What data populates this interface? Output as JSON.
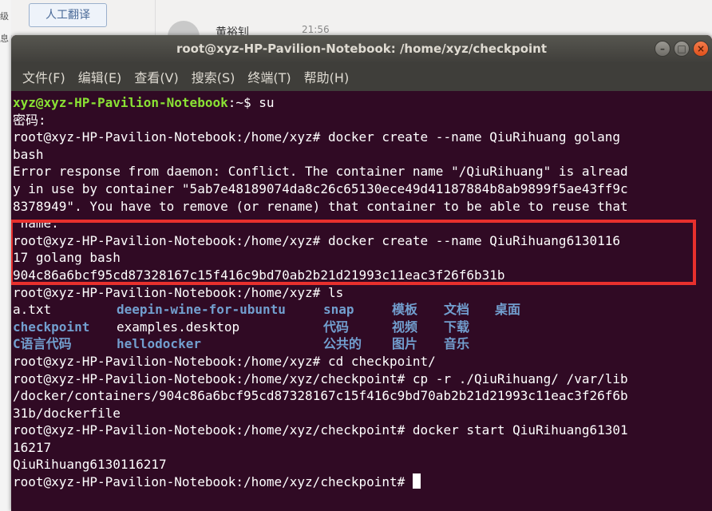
{
  "background": {
    "left_fragments": [
      "级",
      "息"
    ],
    "translate_button": "人工翻译",
    "contact_name": "黄裕钊",
    "contact_time": "21:56"
  },
  "window": {
    "title": "root@xyz-HP-Pavilion-Notebook: /home/xyz/checkpoint",
    "buttons": {
      "minimize": "–",
      "maximize": "□",
      "close": "×"
    }
  },
  "menu": {
    "file": "文件(F)",
    "edit": "编辑(E)",
    "view": "查看(V)",
    "search": "搜索(S)",
    "terminal": "终端(T)",
    "help": "帮助(H)"
  },
  "terminal": {
    "prompt_user_host": "xyz@xyz-HP-Pavilion-Notebook",
    "prompt_user_path": ":~$ su",
    "lines": [
      "密码:",
      "root@xyz-HP-Pavilion-Notebook:/home/xyz# docker create --name QiuRihuang golang",
      "bash",
      "Error response from daemon: Conflict. The container name \"/QiuRihuang\" is alread",
      "y in use by container \"5ab7e48189074da8c26c65130ece49d41187884b8ab9899f5ae43ff9c",
      "8378949\". You have to remove (or rename) that container to be able to reuse that",
      " name.",
      "root@xyz-HP-Pavilion-Notebook:/home/xyz# docker create --name QiuRihuang6130116",
      "17 golang bash",
      "904c86a6bcf95cd87328167c15f416c9bd70ab2b21d21993c11eac3f26f6b31b",
      "root@xyz-HP-Pavilion-Notebook:/home/xyz# ls"
    ],
    "ls_rows": [
      [
        "a.txt",
        "deepin-wine-for-ubuntu",
        "snap",
        "模板",
        "文档",
        "桌面"
      ],
      [
        "checkpoint",
        "examples.desktop",
        "代码",
        "视频",
        "下载",
        ""
      ],
      [
        "C语言代码",
        "hellodocker",
        "公共的",
        "图片",
        "音乐",
        ""
      ]
    ],
    "after_lines": [
      "root@xyz-HP-Pavilion-Notebook:/home/xyz# cd checkpoint/",
      "root@xyz-HP-Pavilion-Notebook:/home/xyz/checkpoint# cp -r ./QiuRihuang/ /var/lib",
      "/docker/containers/904c86a6bcf95cd87328167c15f416c9bd70ab2b21d21993c11eac3f26f6b",
      "31b/dockerfile",
      "root@xyz-HP-Pavilion-Notebook:/home/xyz/checkpoint# docker start QiuRihuang61301",
      "16217",
      "QiuRihuang6130116217"
    ],
    "last_prompt": "root@xyz-HP-Pavilion-Notebook:/home/xyz/checkpoint# "
  },
  "colors": {
    "terminal_bg": "#300a24",
    "prompt_green": "#8ae234",
    "dir_blue": "#729fcf",
    "highlight_red": "#e8302d"
  }
}
